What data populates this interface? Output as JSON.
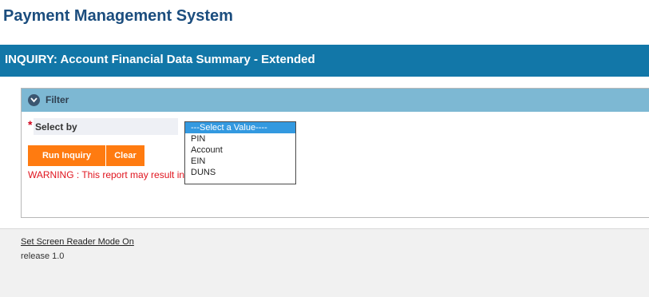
{
  "app": {
    "title": "Payment Management System"
  },
  "page": {
    "heading": "INQUIRY: Account Financial Data Summary - Extended"
  },
  "filter": {
    "title": "Filter",
    "toggle_icon": "chevron-down-icon",
    "required_marker": "*",
    "select_label": "Select by",
    "options": [
      "---Select a Value----",
      "PIN",
      "Account",
      "EIN",
      "DUNS"
    ],
    "selected_index": 0
  },
  "actions": {
    "run_label": "Run Inquiry",
    "clear_label": "Clear"
  },
  "warning": "WARNING : This report may result in",
  "footer": {
    "screen_reader_link": "Set Screen Reader Mode On",
    "release": "release 1.0"
  },
  "colors": {
    "title_text": "#1b4d7e",
    "banner": "#1277a8",
    "filter_header": "#7db8d3",
    "button": "#ff7b10",
    "warning": "#e0141e",
    "selected_option": "#3399e0",
    "footer_bg": "#f1f1f1"
  }
}
